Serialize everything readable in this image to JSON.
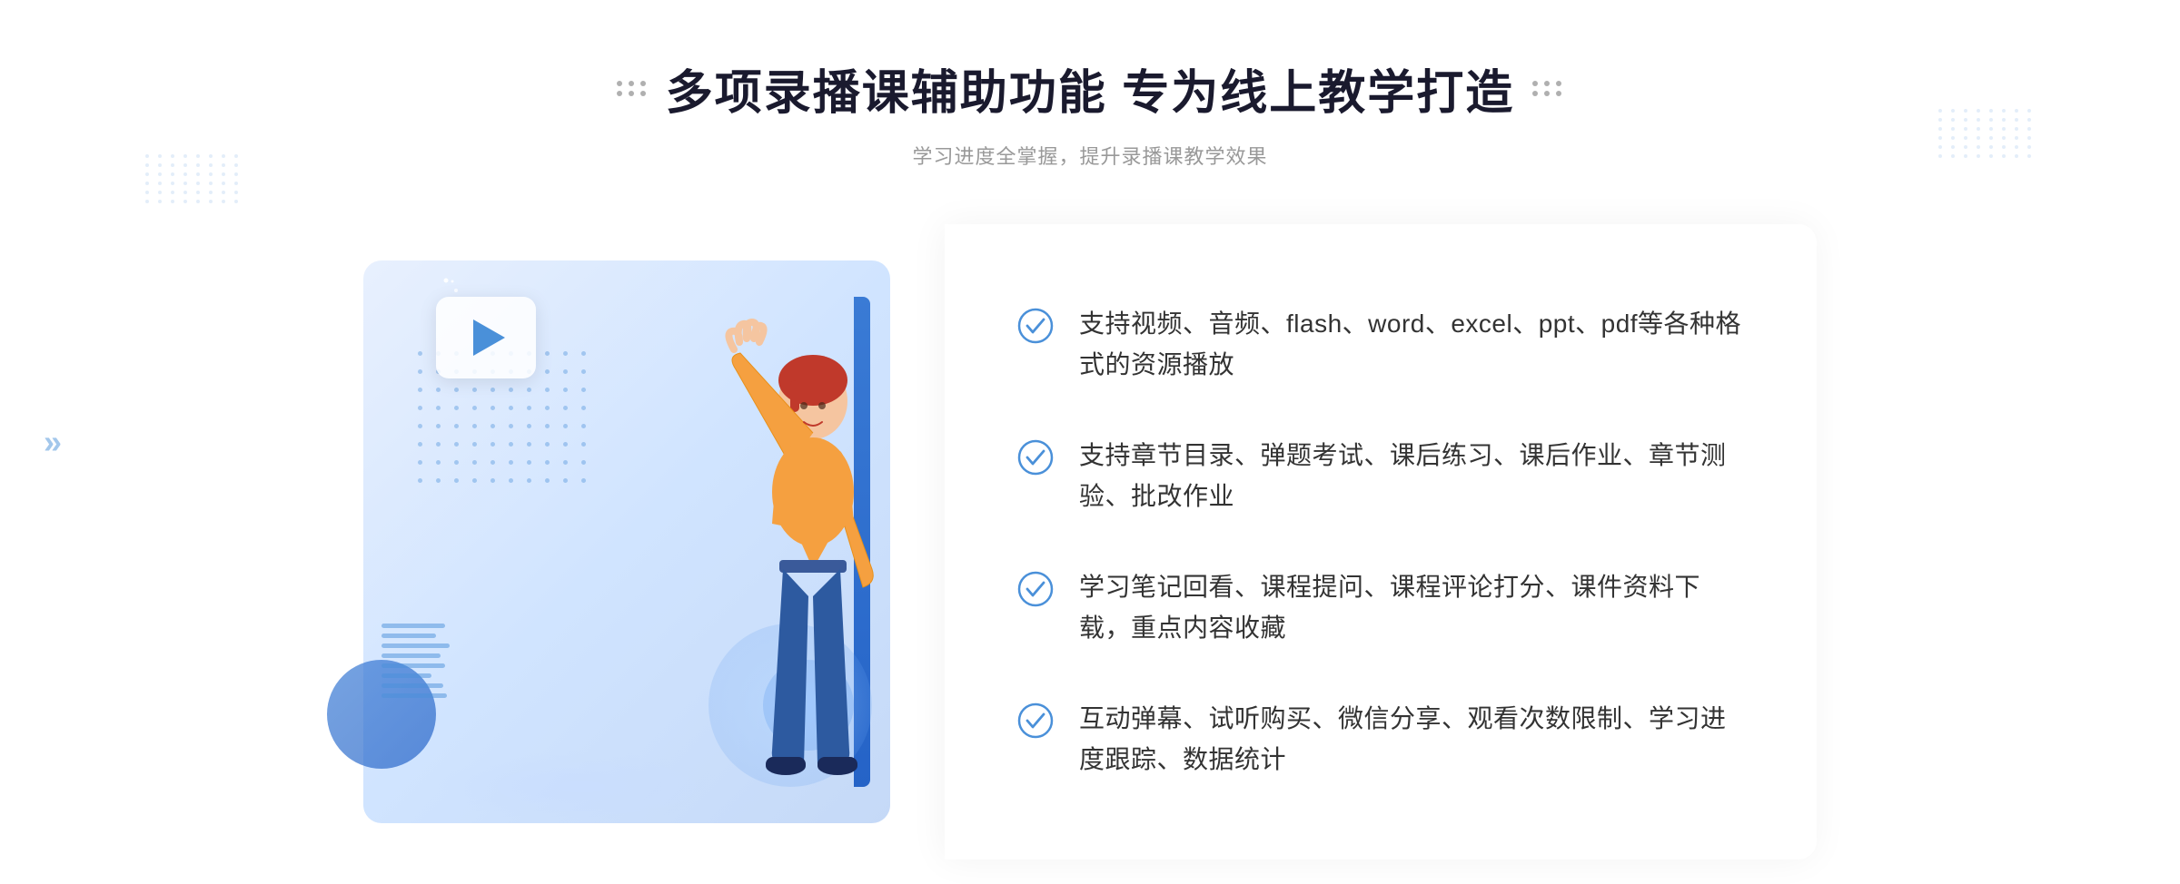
{
  "page": {
    "title": "多项录播课辅助功能 专为线上教学打造",
    "subtitle": "学习进度全掌握，提升录播课教学效果"
  },
  "features": [
    {
      "id": 1,
      "text": "支持视频、音频、flash、word、excel、ppt、pdf等各种格式的资源播放"
    },
    {
      "id": 2,
      "text": "支持章节目录、弹题考试、课后练习、课后作业、章节测验、批改作业"
    },
    {
      "id": 3,
      "text": "学习笔记回看、课程提问、课程评论打分、课件资料下载，重点内容收藏"
    },
    {
      "id": 4,
      "text": "互动弹幕、试听购买、微信分享、观看次数限制、学习进度跟踪、数据统计"
    }
  ],
  "colors": {
    "primary": "#3a7bd5",
    "accent": "#4a90d9",
    "text_dark": "#1a1a2e",
    "text_gray": "#999999",
    "text_body": "#333333"
  },
  "icons": {
    "check": "check-circle",
    "play": "play-triangle",
    "chevron_left": "«",
    "chevron_right": "»"
  }
}
